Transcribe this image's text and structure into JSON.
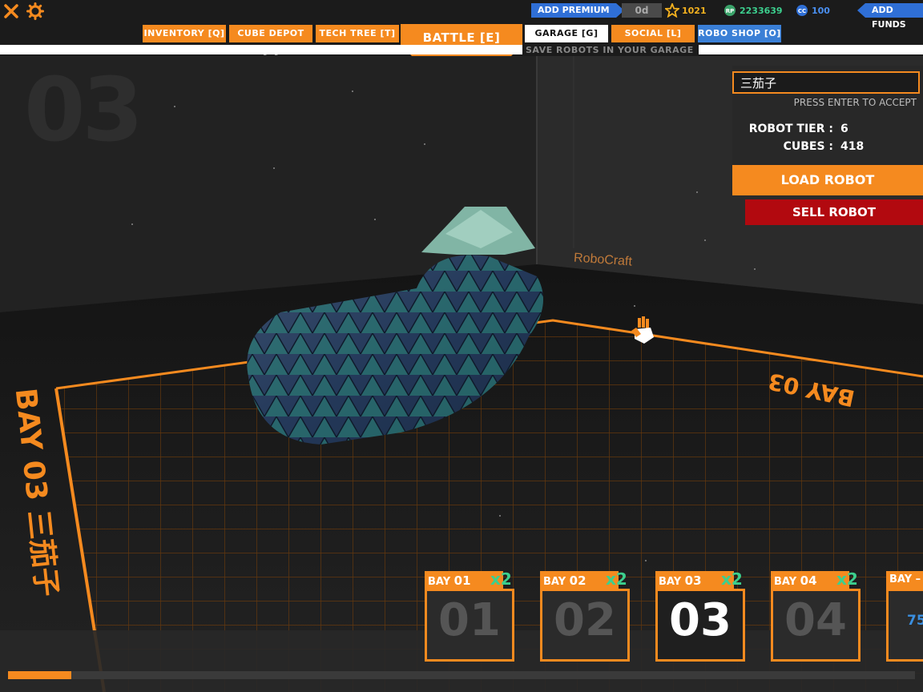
{
  "colors": {
    "accent": "#f58a1f",
    "danger": "#b2090f",
    "premium_blue": "#2f6fd6",
    "green": "#3ccf8e"
  },
  "topbar": {
    "close_icon": "close-icon",
    "settings_icon": "gear-icon",
    "add_premium": "ADD PREMIUM",
    "premium_days": "0d",
    "tech_points": "1021",
    "robits": "2233639",
    "cosmetic_credits": "100",
    "add_funds": "ADD FUNDS"
  },
  "tabs": {
    "inventory": "INVENTORY [Q]",
    "cube_depot": "CUBE DEPOT [C]",
    "tech_tree": "TECH TREE [T]",
    "battle": "BATTLE [E]",
    "garage": "GARAGE [G]",
    "social": "SOCIAL [L]",
    "robo_shop": "ROBO SHOP [O]"
  },
  "garage_subtitle": "SAVE ROBOTS IN YOUR GARAGE",
  "scene": {
    "bay_big_number": "03",
    "floor_text": "BAY 03 三茄子",
    "floor_text_right": "BAY 03",
    "wall_brand": "RoboCraft"
  },
  "panel": {
    "robot_name": "三茄子",
    "hint": "PRESS ENTER TO ACCEPT",
    "tier_label": "ROBOT TIER :",
    "tier_value": "6",
    "cubes_label": "CUBES :",
    "cubes_value": "418",
    "load_robot": "LOAD ROBOT",
    "sell_robot": "SELL ROBOT"
  },
  "bays": [
    {
      "label": "BAY",
      "num": "01",
      "mult": "x2",
      "big": "01"
    },
    {
      "label": "BAY",
      "num": "02",
      "mult": "x2",
      "big": "02"
    },
    {
      "label": "BAY",
      "num": "03",
      "mult": "x2",
      "big": "03"
    },
    {
      "label": "BAY",
      "num": "04",
      "mult": "x2",
      "big": "04"
    },
    {
      "label": "BAY –",
      "num": "",
      "mult": "",
      "big": "75"
    }
  ],
  "progress_fraction": 0.07
}
